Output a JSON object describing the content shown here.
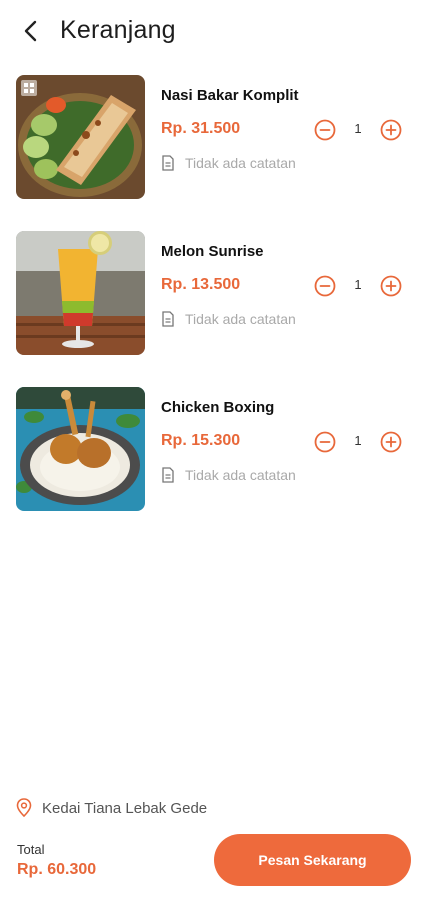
{
  "header": {
    "title": "Keranjang",
    "back_icon": "chevron-left-icon"
  },
  "cart": {
    "items": [
      {
        "name": "Nasi Bakar Komplit",
        "price": "Rp. 31.500",
        "qty": "1",
        "note": "Tidak ada catatan"
      },
      {
        "name": "Melon Sunrise",
        "price": "Rp. 13.500",
        "qty": "1",
        "note": "Tidak ada catatan"
      },
      {
        "name": "Chicken Boxing",
        "price": "Rp. 15.300",
        "qty": "1",
        "note": "Tidak ada catatan"
      }
    ]
  },
  "footer": {
    "location": "Kedai Tiana Lebak Gede",
    "total_label": "Total",
    "total_value": "Rp. 60.300",
    "order_button": "Pesan Sekarang"
  },
  "colors": {
    "accent": "#ee6a3c",
    "price": "#e8683a",
    "muted": "#a9a9a9"
  }
}
